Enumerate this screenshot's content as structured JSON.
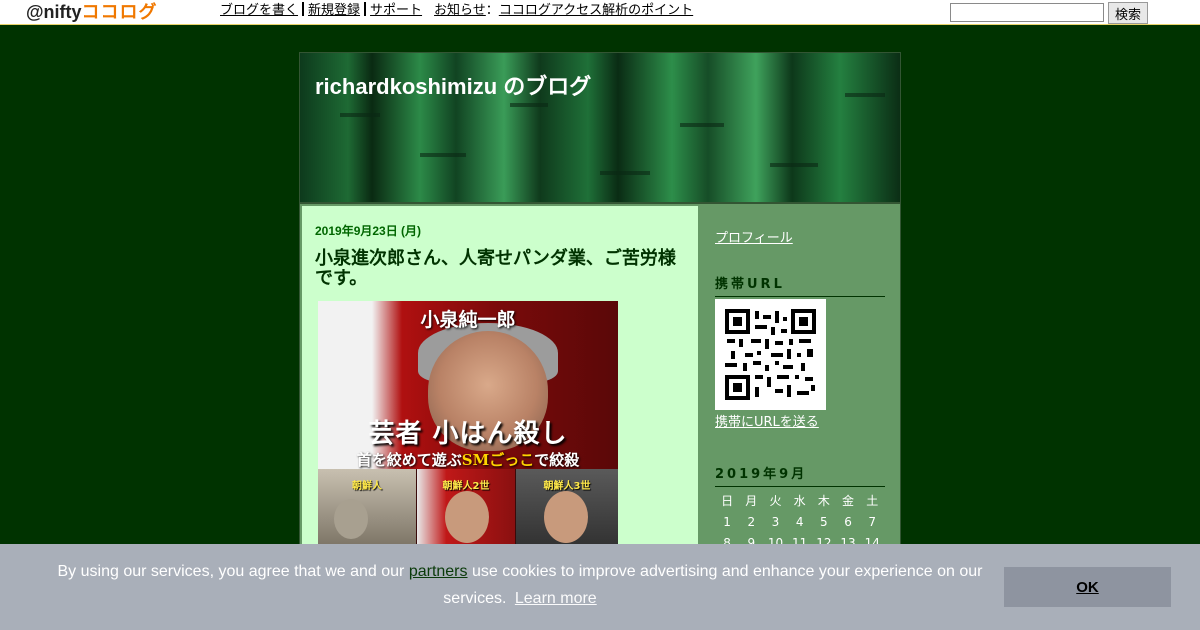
{
  "topbar": {
    "logo_at": "@nifty",
    "logo_brand": "ココログ",
    "nav": [
      "ブログを書く",
      "新規登録",
      "サポート"
    ],
    "notice_label": "お知らせ",
    "notice_sep": "：",
    "notice_link": "ココログアクセス解析のポイント",
    "search_placeholder": "",
    "search_button": "検索"
  },
  "blog": {
    "title": "richardkoshimizu のブログ"
  },
  "post": {
    "date": "2019年9月23日 (月)",
    "title": "小泉進次郎さん、人寄せパンダ業、ご苦労様です。",
    "image": {
      "name": "小泉純一郎",
      "caption1": "芸者 小はん殺し",
      "caption2_pre": "首を絞めて遊ぶ",
      "caption2_em": "SMごっこ",
      "caption2_post": "で絞殺",
      "panel1": "朝鮮人",
      "panel2": "朝鮮人2世",
      "panel3": "朝鮮人3世"
    }
  },
  "sidebar": {
    "profile_link": "プロフィール",
    "mobile_heading": "携帯URL",
    "mobile_link": "携帯にURLを送る",
    "calendar_heading": "2019年9月",
    "weekdays": [
      "日",
      "月",
      "火",
      "水",
      "木",
      "金",
      "土"
    ],
    "weeks": [
      [
        "1",
        "2",
        "3",
        "4",
        "5",
        "6",
        "7"
      ],
      [
        "8",
        "9",
        "10",
        "11",
        "12",
        "13",
        "14"
      ]
    ]
  },
  "cookie": {
    "text_before": "By using our services, you agree that we and our",
    "partners": "partners",
    "text_after": "use cookies to improve advertising and enhance your experience on our services.",
    "learn_more": "Learn more",
    "ok": "OK"
  }
}
